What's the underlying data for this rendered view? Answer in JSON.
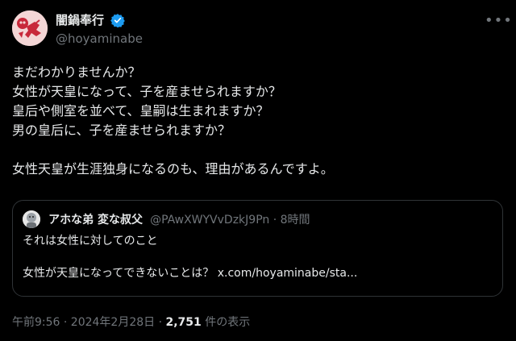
{
  "author": {
    "display_name": "闇鍋奉行",
    "handle": "@hoyaminabe",
    "avatar": "skull-avatar-icon",
    "verified": true,
    "verified_color": "#1d9bf0"
  },
  "more_icon": "more-options-icon",
  "tweet_lines": [
    "まだわかりませんか？",
    "女性が天皇になって、子を産ませられますか？",
    "皇后や側室を並べて、皇嗣は生まれますか？",
    "男の皇后に、子を産ませられますか？",
    "",
    "女性天皇が生涯独身になるのも、理由があるんですよ。"
  ],
  "quote": {
    "display_name": "アホな弟 変な叔父",
    "handle_time": "@PAwXWYVvDzkJ9Pn · 8時間",
    "line1": "それは女性に対してのこと",
    "line2_text": "女性が天皇になってできないことは？ ",
    "line2_link": "x.com/hoyaminabe/sta..."
  },
  "meta": {
    "time_date": "午前9:56 · 2024年2月28日 · ",
    "views_count": "2,751",
    "views_label": " 件の表示"
  },
  "colors": {
    "background": "#000000",
    "text": "#e7e9ea",
    "secondary": "#71767b",
    "border": "#2f3336"
  }
}
